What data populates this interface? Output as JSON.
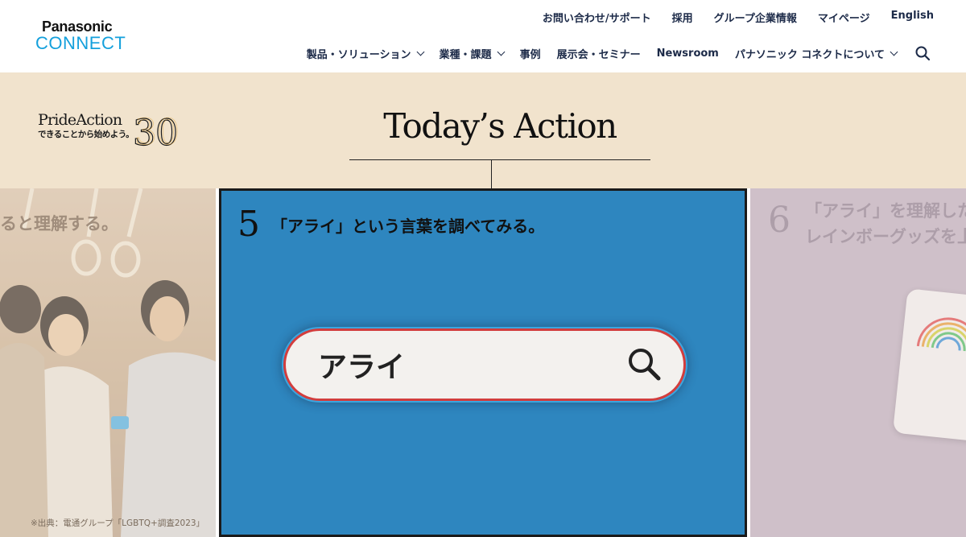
{
  "header": {
    "logo_top": "Panasonic",
    "logo_bottom": "CONNECT",
    "util_nav": [
      "お問い合わせ/サポート",
      "採用",
      "グループ企業情報",
      "マイページ",
      "English"
    ],
    "main_nav": [
      {
        "label": "製品・ソリューション",
        "dropdown": true
      },
      {
        "label": "業種・課題",
        "dropdown": true
      },
      {
        "label": "事例",
        "dropdown": false
      },
      {
        "label": "展示会・セミナー",
        "dropdown": false
      },
      {
        "label": "Newsroom",
        "dropdown": false
      },
      {
        "label": "パナソニック コネクトについて",
        "dropdown": true
      }
    ],
    "search_icon": "search-icon"
  },
  "hero": {
    "pride_title": "PrideAction",
    "pride_number": "30",
    "pride_sub": "できることから始めよう。",
    "heading": "Today’s Action"
  },
  "cards": {
    "left": {
      "caption": "ると理解する。",
      "source": "※出典：電通グループ「LGBTQ+調査2023」"
    },
    "main": {
      "number": "5",
      "text": "「アライ」という言葉を調べてみる。",
      "search_text": "アライ"
    },
    "right": {
      "number": "6",
      "line1": "「アライ」を理解した",
      "line2": "レインボーグッズを上"
    }
  },
  "colors": {
    "brand_blue": "#14a0dc",
    "nav_text": "#1c2a48",
    "band_bg": "#f1e3cd",
    "card_blue": "#2e86bf"
  }
}
